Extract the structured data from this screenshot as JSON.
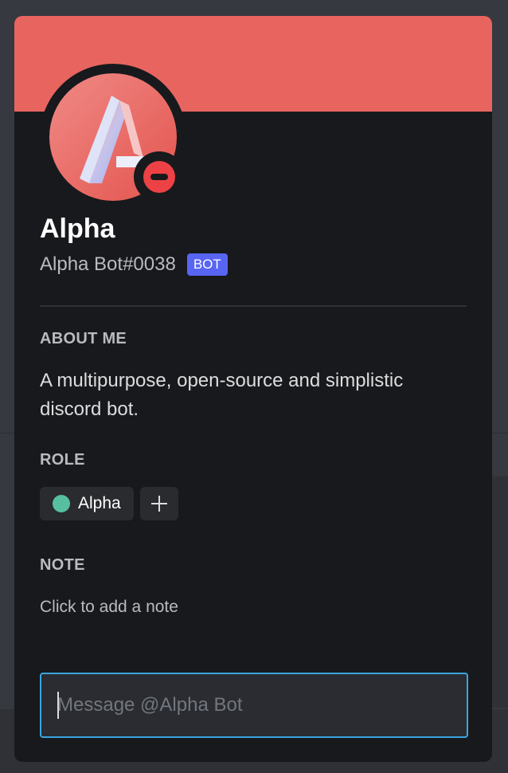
{
  "profile": {
    "display_name": "Alpha",
    "tag": "Alpha Bot#0038",
    "bot_badge": "BOT",
    "banner_color": "#e8655f",
    "status": "do-not-disturb",
    "status_color": "#ed4245"
  },
  "about": {
    "title": "ABOUT ME",
    "text": "A multipurpose, open-source and simplistic discord bot."
  },
  "role": {
    "title": "ROLE",
    "items": [
      {
        "name": "Alpha",
        "color": "#57bf9f"
      }
    ],
    "add_icon": "plus-icon"
  },
  "note": {
    "title": "NOTE",
    "placeholder": "Click to add a note"
  },
  "message": {
    "placeholder": "Message @Alpha Bot",
    "value": ""
  }
}
